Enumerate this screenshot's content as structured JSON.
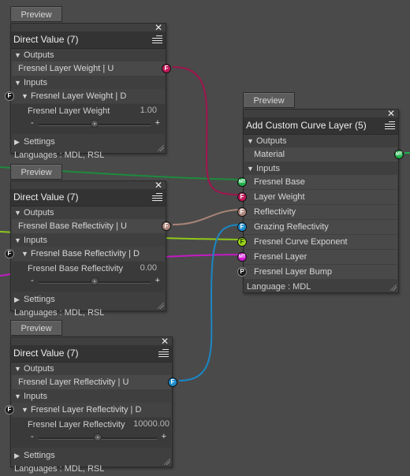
{
  "colors": {
    "float_port": "#c0185a",
    "color_port": "#b08a80",
    "blue_port": "#1e8fcf",
    "green_port": "#22b24c",
    "lime_port": "#9ad21a",
    "magenta_port": "#d31ad3",
    "dark_port": "#1a1a1a"
  },
  "glyphs": {
    "close": "✕",
    "expanded": "▼",
    "collapsed": "▶",
    "minus": "-",
    "plus": "+"
  },
  "nodes": [
    {
      "preview_label": "Preview",
      "title": "Direct Value (7)",
      "outputs_label": "Outputs",
      "output_row": "Fresnel Layer Weight  | U",
      "output_port": "F",
      "inputs_label": "Inputs",
      "input_row": "Fresnel Layer Weight  | D",
      "input_port": "F",
      "param_label": "Fresnel Layer Weight",
      "param_value": "1.00",
      "slider_fraction": 0.5,
      "settings_label": "Settings",
      "languages": "Languages : MDL, RSL"
    },
    {
      "preview_label": "Preview",
      "title": "Direct Value (7)",
      "outputs_label": "Outputs",
      "output_row": "Fresnel Base Reflectivity  | U",
      "output_port": "F",
      "inputs_label": "Inputs",
      "input_row": "Fresnel Base Reflectivity  | D",
      "input_port": "F",
      "param_label": "Fresnel Base Reflectivity",
      "param_value": "0.00",
      "slider_fraction": 0.5,
      "settings_label": "Settings",
      "languages": "Languages : MDL, RSL"
    },
    {
      "preview_label": "Preview",
      "title": "Direct Value (7)",
      "outputs_label": "Outputs",
      "output_row": "Fresnel Layer Reflectivity  | U",
      "output_port": "F",
      "inputs_label": "Inputs",
      "input_row": "Fresnel Layer Reflectivity  | D",
      "input_port": "F",
      "param_label": "Fresnel Layer Reflectivity",
      "param_value": "10000.00",
      "slider_fraction": 0.5,
      "settings_label": "Settings",
      "languages": "Languages : MDL, RSL"
    }
  ],
  "curve_node": {
    "preview_label": "Preview",
    "title": "Add Custom Curve Layer (5)",
    "outputs_label": "Outputs",
    "output_row": "Material",
    "output_port": "MT",
    "inputs_label": "Inputs",
    "inputs": [
      {
        "label": "Fresnel Base",
        "port": "MT"
      },
      {
        "label": "Layer Weight",
        "port": "F"
      },
      {
        "label": "Reflectivity",
        "port": "F"
      },
      {
        "label": "Grazing Reflectivity",
        "port": "F"
      },
      {
        "label": "Fresnel Curve Exponent",
        "port": "F"
      },
      {
        "label": "Fresnel Layer",
        "port": "MT"
      },
      {
        "label": "Fresnel Layer Bump",
        "port": "P"
      }
    ],
    "languages": "Language : MDL"
  }
}
